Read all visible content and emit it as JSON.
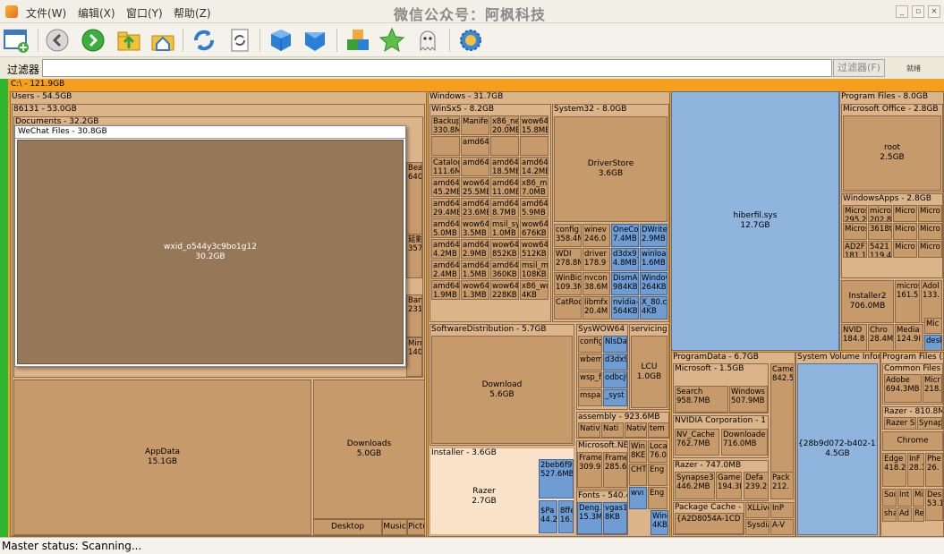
{
  "menubar": {
    "menus": [
      "文件(W)",
      "编辑(X)",
      "窗口(Y)",
      "帮助(Z)"
    ],
    "watermark": "微信公众号：阿枫科技"
  },
  "toolbar": {
    "icons": [
      "new-scan-icon",
      "back-icon",
      "forward-icon",
      "up-folder-icon",
      "home-icon",
      "refresh-icon",
      "refresh-page-icon",
      "blue-cube-icon",
      "blue-shape-icon",
      "colored-blocks-icon",
      "green-star-icon",
      "ghost-icon",
      "settings-gear-icon"
    ]
  },
  "filter": {
    "label": "过滤器",
    "value": "",
    "button": "过滤器(F)",
    "status": "就绪"
  },
  "colors": {
    "root_bar": "#f59f1e",
    "side_bar": "#2fb52f",
    "file_blue": "#8fb4de",
    "folder_brown": "#c79a6b"
  },
  "treemap": {
    "root": "C:\\ - 121.9GB",
    "users": "Users - 54.5GB",
    "user86131": "86131 - 53.0GB",
    "documents": "Documents - 32.2GB",
    "wechat_files": "WeChat Files - 30.8GB",
    "wxid_name": "wxid_o544y3c9bo1g12",
    "wxid_size": "30.2GB",
    "doc_items": [
      "Bea\n640",
      "延影\n357",
      "Ban\n231",
      "Mirr\n140"
    ],
    "appdata_name": "AppData",
    "appdata_size": "15.1GB",
    "downloads_name": "Downloads",
    "downloads_size": "5.0GB",
    "desktop": "Desktop",
    "music": "Music",
    "pictures": "Pictu",
    "windows": "Windows - 31.7GB",
    "winsxs": "WinSxS - 8.2GB",
    "winsxs_cells": [
      "Backup\n330.8ME",
      "Manife\n",
      "x86_ne\n20.0MB",
      "wow64\n15.8ME",
      "",
      "amd64\n",
      "",
      "",
      "Catalog\n111.6ME",
      "amd64\n",
      "amd64\n18.5ME",
      "amd64\n14.2ME",
      "amd64\n45.2ME",
      "wow64\n25.5MB",
      "amd64\n11.0MB",
      "x86_mi\n7.0MB",
      "amd64\n29.4ME",
      "amd64\n23.6ME",
      "amd64\n8.7MB",
      "amd64\n5.9MB",
      "amd64\n5.0MB",
      "wow64\n3.5MB",
      "msil_sy\n1.0MB",
      "wow64\n676KB",
      "amd64\n4.2MB",
      "amd64\n2.9MB",
      "wow64\n852KB",
      "wow64\n512KB",
      "amd64\n2.4MB",
      "amd64\n1.5MB",
      "amd64\n360KB",
      "msil_m\n108KB",
      "amd64\n1.9MB",
      "wow64\n1.3MB",
      "wow64\n228KB",
      "x86_wo\n4KB"
    ],
    "system32": "System32 - 8.0GB",
    "driverstore_name": "DriverStore",
    "driverstore_size": "3.6GB",
    "sys32_cells": [
      "config\n358.4ME",
      "winev\n246.0",
      "OneCo\n7.4MB",
      "DWrite\n2.9MB",
      "WDI\n278.8ME",
      "driver\n178.9",
      "d3dx9_\n4.8MB",
      "winloa\n1.6MB",
      "WinBioP\n109.3ME",
      "nvcon\n38.6M",
      "DismA\n984KB",
      "Window\n264KB",
      "CatRoot",
      "libmfx\n20.4M",
      "nvidia-\n564KB",
      "X_80.cc\n4KB"
    ],
    "softdist": "SoftwareDistribution - 5.7GB",
    "download_name": "Download",
    "download_size": "5.6GB",
    "syswow64": "SysWOW64 -",
    "sw_cells": [
      "config",
      "NlsDa",
      "wbem",
      "d3dx9",
      "wsp_f",
      "odbcjt",
      "mspai",
      "_syst"
    ],
    "servicing": "servicing -",
    "lcu_name": "LCU",
    "lcu_size": "1.0GB",
    "assembly": "assembly - 923.6MB",
    "asm_cells": [
      "Native",
      "Nati",
      "Native",
      "tem"
    ],
    "msnet": "Microsoft.NET",
    "net_cells": [
      "Frame\n309.9I",
      "Frame\n285.6",
      "Win\n8KE",
      "Loca\n76.0",
      "CHT",
      "Eng",
      "wvı",
      "Eng"
    ],
    "fonts": "Fonts - 540.4",
    "font_cells": [
      "Deng.\n15.3M",
      "vgas1\n8KB",
      "Wind\n4KB"
    ],
    "installer": "Installer - 3.6GB",
    "razer_inst_name": "Razer",
    "razer_inst_size": "2.7GB",
    "inst_cells": [
      "2beb6f9t\n527.6MB",
      "$Pa\n44.2",
      "8ffe\n16.5"
    ],
    "hiberfil_name": "hiberfil.sys",
    "hiberfil_size": "12.7GB",
    "programfiles": "Program Files - 8.0GB",
    "msoffice": "Microsoft Office - 2.8GB",
    "root_name": "root",
    "root_size": "2.5GB",
    "windowsapps": "WindowsApps - 2.8GB",
    "wa_cells": [
      "Microsc\n295.2M",
      "micro\n202.8",
      "Micro",
      "Micro",
      "Microsc",
      "3618t",
      "Micro",
      "Micro",
      "AD2F1\n181.1M",
      "5421\n119.4",
      "Micro",
      "Micro"
    ],
    "installer2_name": "Installer2",
    "installer2_size": "706.0MB",
    "pf_cells": [
      "micros\n161.5",
      "Adol\n133.",
      "NVID\n184.8",
      "Chro\n28.4M",
      "Media\n124.9I",
      "Mic",
      "desk"
    ],
    "programdata": "ProgramData - 6.7GB",
    "ms_pd": "Microsoft - 1.5GB",
    "pd_cells": [
      "Search\n958.7MB",
      "Windows\n507.9MB",
      "Came\n842.5"
    ],
    "nvidia_corp": "NVIDIA Corporation - 1",
    "nv_cells": [
      "NV_Cache\n762.7MB",
      "Downloade\n716.0MB"
    ],
    "razer_pd": "Razer - 747.0MB",
    "rz_cells": [
      "Synapse3\n446.2MB",
      "Gamel\n194.3M",
      "Defa\n239.2",
      "Pack\n212."
    ],
    "pkgcache": "Package Cache - 6",
    "pc_cells": [
      "{A2D8054A-1CD",
      "XLLive",
      "InP",
      "Sysdia",
      "A-V"
    ],
    "svi": "System Volume Infor",
    "svi_name": "{28b9d072-b402-11e",
    "svi_size": "4.5GB",
    "pfx86": "Program Files (x8",
    "common": "Common Files -",
    "cf_cells": [
      "Adobe\n694.3MB",
      "Micr\n218.5"
    ],
    "razer_x86": "Razer - 810.8MB",
    "rx_cells": [
      "Razer Se",
      "Synap"
    ],
    "chrome": "Chrome",
    "x86_cells": [
      "Edge\n418.2",
      "InF\n28.1",
      "Phe\n26.",
      "Soı",
      "Int",
      "Micr",
      "Desk\n53.1I",
      "sha",
      "Ad",
      "Re"
    ]
  },
  "status": {
    "text": "Master status: Scanning..."
  }
}
